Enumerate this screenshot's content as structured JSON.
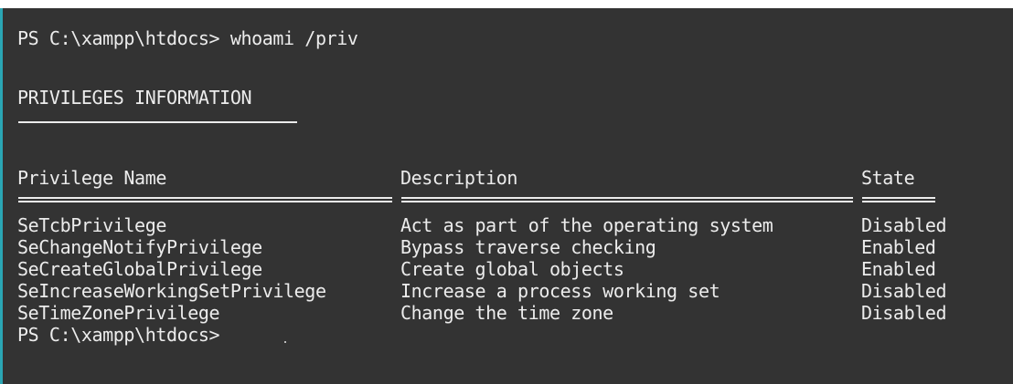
{
  "terminal": {
    "command_line": "PS C:\\xampp\\htdocs> whoami /priv",
    "section_title": "PRIVILEGES INFORMATION",
    "headers": {
      "name": "Privilege Name",
      "description": "Description",
      "state": "State"
    },
    "rows": [
      {
        "name": "SeTcbPrivilege",
        "description": "Act as part of the operating system",
        "state": "Disabled"
      },
      {
        "name": "SeChangeNotifyPrivilege",
        "description": "Bypass traverse checking",
        "state": "Enabled"
      },
      {
        "name": "SeCreateGlobalPrivilege",
        "description": "Create global objects",
        "state": "Enabled"
      },
      {
        "name": "SeIncreaseWorkingSetPrivilege",
        "description": "Increase a process working set",
        "state": "Disabled"
      },
      {
        "name": "SeTimeZonePrivilege",
        "description": "Change the time zone",
        "state": "Disabled"
      }
    ],
    "prompt": "PS C:\\xampp\\htdocs>"
  },
  "colors": {
    "background": "#333333",
    "text": "#ececec",
    "accent_border": "#2aa6b4"
  }
}
